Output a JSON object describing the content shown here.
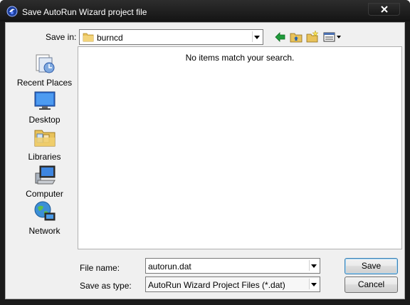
{
  "window": {
    "title": "Save AutoRun Wizard project file",
    "close_icon": "close-icon",
    "app_icon": "autorun-app-icon"
  },
  "toolbar": {
    "save_in_label": "Save in:",
    "save_in_value": "burncd",
    "icons": [
      "back-arrow-icon",
      "up-folder-icon",
      "new-folder-icon",
      "view-menu-icon"
    ]
  },
  "places": [
    {
      "label": "Recent Places",
      "icon": "recent-places-icon"
    },
    {
      "label": "Desktop",
      "icon": "desktop-icon"
    },
    {
      "label": "Libraries",
      "icon": "libraries-icon"
    },
    {
      "label": "Computer",
      "icon": "computer-icon"
    },
    {
      "label": "Network",
      "icon": "network-icon"
    }
  ],
  "filelist": {
    "empty_message": "No items match your search."
  },
  "form": {
    "file_name_label": "File name:",
    "file_name_value": "autorun.dat",
    "save_as_type_label": "Save as type:",
    "save_as_type_value": "AutoRun Wizard Project Files (*.dat)"
  },
  "buttons": {
    "save": "Save",
    "cancel": "Cancel"
  },
  "colors": {
    "titlebar": "#1b1b1b",
    "dialog_background": "#f0f0f0",
    "accent_arrow": "#1f9a3a",
    "folder": "#e8c25a"
  }
}
